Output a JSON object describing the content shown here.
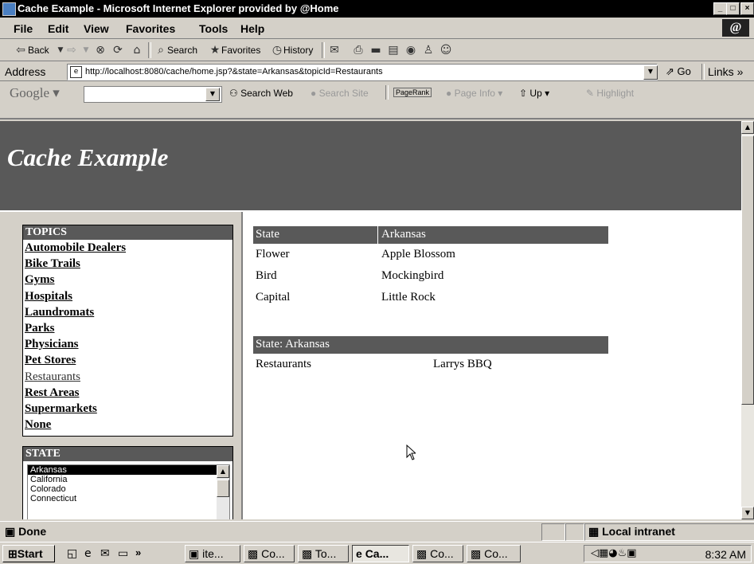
{
  "window": {
    "title": "Cache Example - Microsoft Internet Explorer provided by @Home",
    "controls": [
      "_",
      "□",
      "×"
    ]
  },
  "menu": [
    "File",
    "Edit",
    "View",
    "Favorites",
    "Tools",
    "Help"
  ],
  "toolbar": {
    "back": "Back",
    "search": "Search",
    "favorites": "Favorites",
    "history": "History"
  },
  "address": {
    "label": "Address",
    "url": "http://localhost:8080/cache/home.jsp?&state=Arkansas&topicId=Restaurants",
    "go": "Go",
    "links": "Links »"
  },
  "googlebar": {
    "logo": "Google",
    "search_web": "Search Web",
    "search_site": "Search Site",
    "pagerank": "PageRank",
    "page_info": "Page Info",
    "up": "Up",
    "highlight": "Highlight"
  },
  "page": {
    "title": "Cache Example",
    "topics_header": "TOPICS",
    "topics": [
      "Automobile Dealers",
      "Bike Trails",
      "Gyms",
      "Hospitals",
      "Laundromats",
      "Parks",
      "Physicians",
      "Pet Stores",
      "Restaurants",
      "Rest Areas",
      "Supermarkets",
      "None"
    ],
    "state_header": "STATE",
    "states": [
      "Arkansas",
      "California",
      "Colorado",
      "Connecticut"
    ],
    "selected_state": "Arkansas",
    "state_table": {
      "header": [
        "State",
        "Arkansas"
      ],
      "rows": [
        [
          "Flower",
          "Apple Blossom"
        ],
        [
          "Bird",
          "Mockingbird"
        ],
        [
          "Capital",
          "Little Rock"
        ]
      ]
    },
    "topic_table": {
      "header": "State:  Arkansas",
      "rows": [
        [
          "Restaurants",
          "Larrys BBQ"
        ]
      ]
    }
  },
  "status": {
    "text": "Done",
    "zone": "Local intranet"
  },
  "taskbar": {
    "start": "Start",
    "tasks": [
      "ite...",
      "Co...",
      "To...",
      "Ca...",
      "Co...",
      "Co..."
    ],
    "clock": "8:32 AM"
  }
}
